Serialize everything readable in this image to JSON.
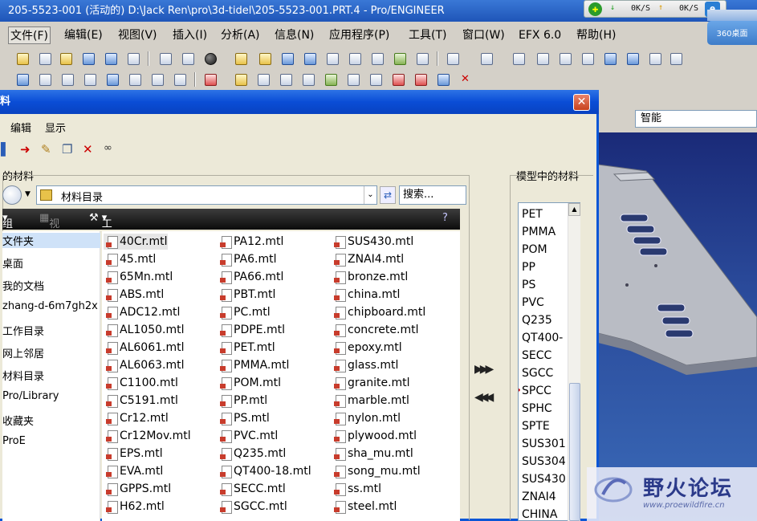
{
  "window": {
    "title": "205-5523-001 (活动的) D:\\Jack Ren\\pro\\3d-tidel\\205-5523-001.PRT.4 - Pro/ENGINEER"
  },
  "netmeter": {
    "download": "0K/S",
    "upload": "0K/S",
    "desk_label": "360桌面"
  },
  "menubar": {
    "items": [
      {
        "label": "文件(F)",
        "name": "menu-file"
      },
      {
        "label": "编辑(E)",
        "name": "menu-edit"
      },
      {
        "label": "视图(V)",
        "name": "menu-view"
      },
      {
        "label": "插入(I)",
        "name": "menu-insert"
      },
      {
        "label": "分析(A)",
        "name": "menu-analysis"
      },
      {
        "label": "信息(N)",
        "name": "menu-info"
      },
      {
        "label": "应用程序(P)",
        "name": "menu-applications"
      },
      {
        "label": "工具(T)",
        "name": "menu-tools"
      },
      {
        "label": "窗口(W)",
        "name": "menu-window"
      },
      {
        "label": "EFX 6.0",
        "name": "menu-efx"
      },
      {
        "label": "帮助(H)",
        "name": "menu-help"
      }
    ]
  },
  "filter_box": {
    "value": "智能"
  },
  "dialog": {
    "title": "料",
    "menu": {
      "edit": "编辑",
      "display": "显示"
    },
    "local_materials_label": "的材料",
    "model_materials_label": "模型中的材料",
    "path": "材料目录",
    "search_placeholder": "搜索...",
    "bar": {
      "organize": "组织",
      "view": "视图",
      "tools": "工具"
    },
    "side_items": [
      "文件夹",
      "桌面",
      "我的文档",
      "zhang-d-6m7gh2x",
      "工作目录",
      "网上邻居",
      "材料目录",
      "Pro/Library",
      "收藏夹",
      "ProE"
    ],
    "files_col1": [
      "40Cr.mtl",
      "45.mtl",
      "65Mn.mtl",
      "ABS.mtl",
      "ADC12.mtl",
      "AL1050.mtl",
      "AL6061.mtl",
      "AL6063.mtl",
      "C1100.mtl",
      "C5191.mtl",
      "Cr12.mtl",
      "Cr12Mov.mtl",
      "EPS.mtl",
      "EVA.mtl",
      "GPPS.mtl",
      "H62.mtl"
    ],
    "files_col2": [
      "PA12.mtl",
      "PA6.mtl",
      "PA66.mtl",
      "PBT.mtl",
      "PC.mtl",
      "PDPE.mtl",
      "PET.mtl",
      "PMMA.mtl",
      "POM.mtl",
      "PP.mtl",
      "PS.mtl",
      "PVC.mtl",
      "Q235.mtl",
      "QT400-18.mtl",
      "SECC.mtl",
      "SGCC.mtl"
    ],
    "files_col3": [
      "SUS430.mtl",
      "ZNAI4.mtl",
      "bronze.mtl",
      "china.mtl",
      "chipboard.mtl",
      "concrete.mtl",
      "epoxy.mtl",
      "glass.mtl",
      "granite.mtl",
      "marble.mtl",
      "nylon.mtl",
      "plywood.mtl",
      "sha_mu.mtl",
      "song_mu.mtl",
      "ss.mtl",
      "steel.mtl"
    ],
    "model_materials": [
      "PET",
      "PMMA",
      "POM",
      "PP",
      "PS",
      "PVC",
      "Q235",
      "QT400-",
      "SECC",
      "SGCC",
      "SPCC",
      "SPHC",
      "SPTE",
      "SUS301",
      "SUS304",
      "SUS430",
      "ZNAI4",
      "CHINA"
    ],
    "current_material_index": 10
  },
  "watermark": {
    "title": "野火论坛",
    "url": "www.proewildfire.cn"
  }
}
